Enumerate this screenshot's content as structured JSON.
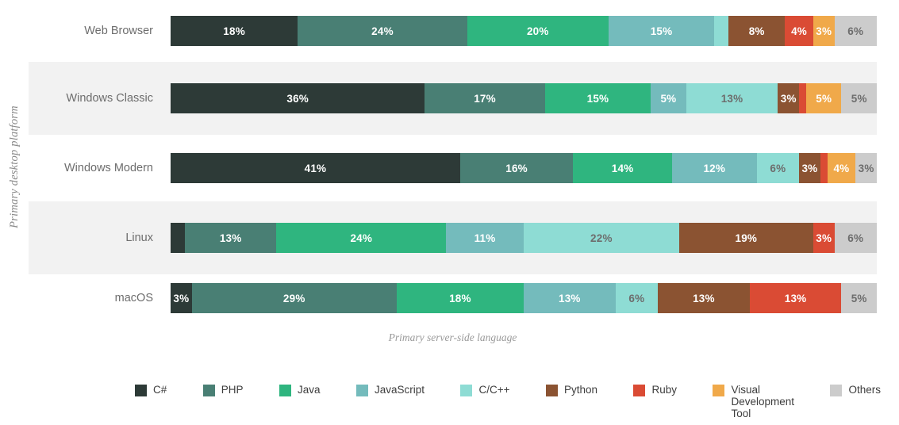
{
  "chart_data": {
    "type": "bar",
    "subtype": "100% stacked horizontal bar",
    "title": "",
    "xlabel": "Primary server-side language",
    "ylabel": "Primary desktop platform",
    "grid": false,
    "legend_position": "bottom",
    "xlim": [
      0,
      100
    ],
    "unit": "%",
    "categories": [
      "Web Browser",
      "Windows Classic",
      "Windows Modern",
      "Linux",
      "macOS"
    ],
    "series": [
      {
        "name": "C#",
        "color": "#2d3a37",
        "values": [
          18,
          36,
          41,
          2,
          3
        ],
        "labels": [
          "18%",
          "36%",
          "41%",
          "",
          "3%"
        ]
      },
      {
        "name": "PHP",
        "color": "#497f74",
        "values": [
          24,
          17,
          16,
          13,
          29
        ],
        "labels": [
          "24%",
          "17%",
          "16%",
          "13%",
          "29%"
        ]
      },
      {
        "name": "Java",
        "color": "#2fb57f",
        "values": [
          20,
          15,
          14,
          24,
          18
        ],
        "labels": [
          "20%",
          "15%",
          "14%",
          "24%",
          "18%"
        ]
      },
      {
        "name": "JavaScript",
        "color": "#74bbbc",
        "values": [
          15,
          5,
          12,
          11,
          13
        ],
        "labels": [
          "15%",
          "5%",
          "12%",
          "11%",
          "13%"
        ]
      },
      {
        "name": "C/C++",
        "color": "#8edcd4",
        "values": [
          2,
          13,
          6,
          22,
          6
        ],
        "labels": [
          "",
          "13%",
          "6%",
          "22%",
          "6%"
        ]
      },
      {
        "name": "Python",
        "color": "#8b5332",
        "values": [
          8,
          3,
          3,
          19,
          13
        ],
        "labels": [
          "8%",
          "3%",
          "3%",
          "19%",
          "13%"
        ]
      },
      {
        "name": "Ruby",
        "color": "#da4b34",
        "values": [
          4,
          1,
          1,
          3,
          13
        ],
        "labels": [
          "4%",
          "",
          "",
          "3%",
          "13%"
        ]
      },
      {
        "name": "Visual Development Tool",
        "color": "#f0a94a",
        "values": [
          3,
          5,
          4,
          0,
          0
        ],
        "labels": [
          "3%",
          "5%",
          "4%",
          "",
          ""
        ]
      },
      {
        "name": "Others",
        "color": "#cccccc",
        "values": [
          6,
          5,
          3,
          6,
          5
        ],
        "labels": [
          "6%",
          "5%",
          "3%",
          "6%",
          "5%"
        ]
      }
    ],
    "label_text_dark_series": [
      "C/C++",
      "Others"
    ],
    "banded_rows": [
      "Windows Classic",
      "Linux"
    ],
    "band_color": "#f2f2f2"
  },
  "legend": {
    "items": [
      {
        "label": "C#",
        "color": "#2d3a37"
      },
      {
        "label": "PHP",
        "color": "#497f74"
      },
      {
        "label": "Java",
        "color": "#2fb57f"
      },
      {
        "label": "JavaScript",
        "color": "#74bbbc"
      },
      {
        "label": "C/C++",
        "color": "#8edcd4"
      },
      {
        "label": "Python",
        "color": "#8b5332"
      },
      {
        "label": "Ruby",
        "color": "#da4b34"
      },
      {
        "label": "Visual\nDevelopment\nTool",
        "color": "#f0a94a"
      },
      {
        "label": "Others",
        "color": "#cccccc"
      }
    ]
  }
}
